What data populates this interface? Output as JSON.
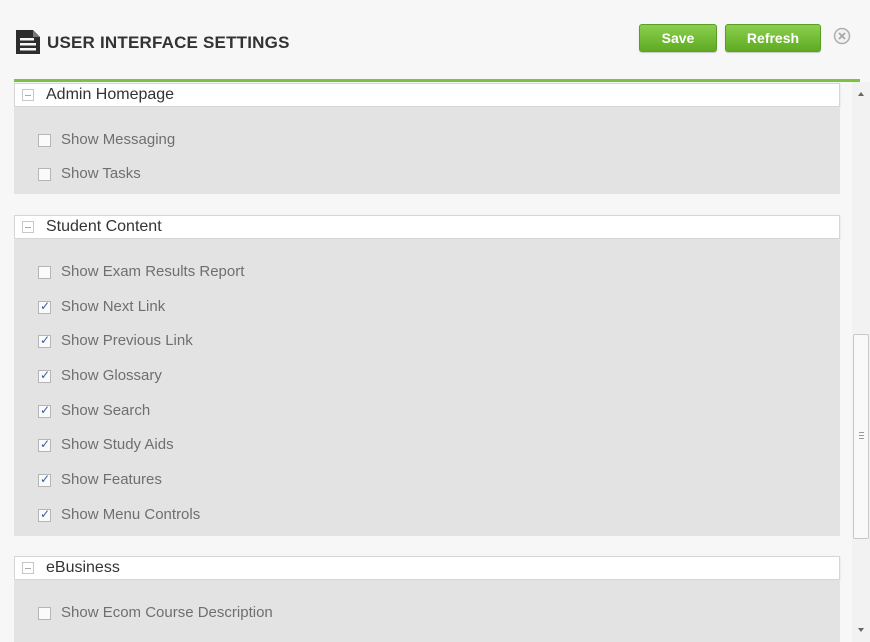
{
  "header": {
    "title": "USER INTERFACE SETTINGS",
    "icon": "document-icon",
    "save_label": "Save",
    "refresh_label": "Refresh",
    "close_icon": "close-icon"
  },
  "colors": {
    "accent": "#7cc242",
    "button": "#6fbb2f",
    "section_body": "#e3e3e3",
    "checkmark": "#3a5d9e"
  },
  "sections": [
    {
      "title": "Admin Homepage",
      "items": [
        {
          "label": "Show Messaging",
          "checked": false
        },
        {
          "label": "Show Tasks",
          "checked": false
        }
      ]
    },
    {
      "title": "Student Content",
      "items": [
        {
          "label": "Show Exam Results Report",
          "checked": false
        },
        {
          "label": "Show Next Link",
          "checked": true
        },
        {
          "label": "Show Previous Link",
          "checked": true
        },
        {
          "label": "Show Glossary",
          "checked": true
        },
        {
          "label": "Show Search",
          "checked": true
        },
        {
          "label": "Show Study Aids",
          "checked": true
        },
        {
          "label": "Show Features",
          "checked": true
        },
        {
          "label": "Show Menu Controls",
          "checked": true
        }
      ]
    },
    {
      "title": "eBusiness",
      "items": [
        {
          "label": "Show Ecom Course Description",
          "checked": false
        }
      ]
    }
  ]
}
